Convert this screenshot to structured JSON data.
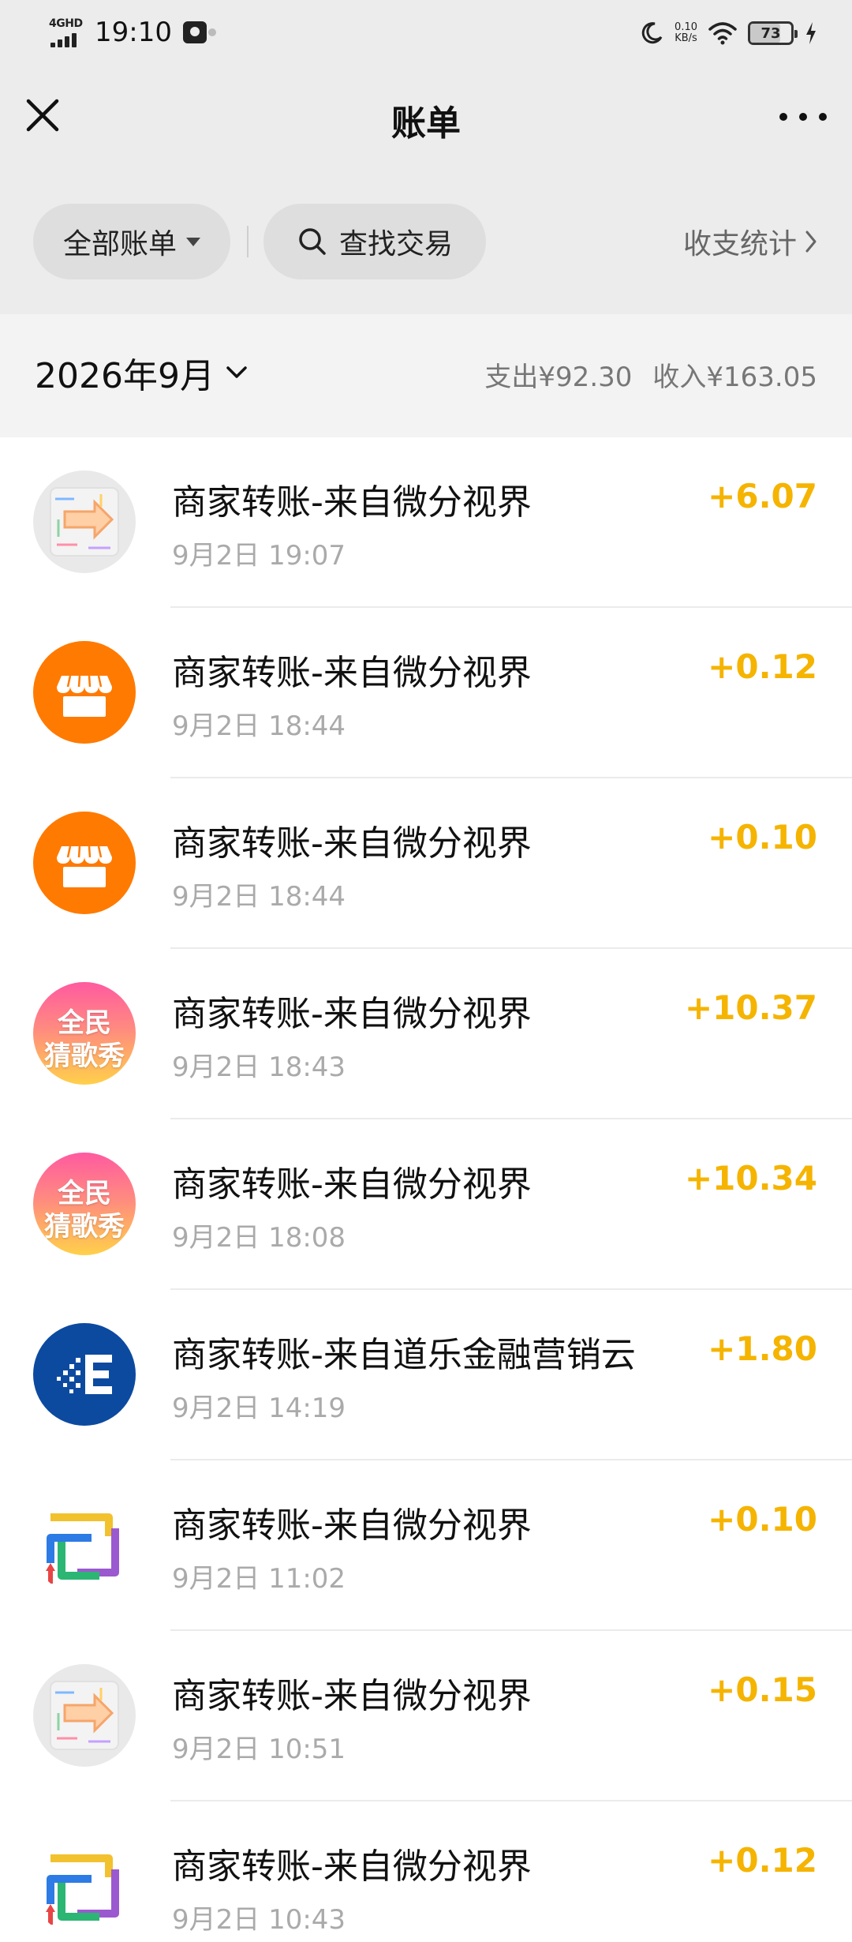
{
  "status_bar": {
    "network": "4GHD",
    "time": "19:10",
    "speed_value": "0.10",
    "speed_unit": "KB/s",
    "battery": "73"
  },
  "nav": {
    "title": "账单"
  },
  "filters": {
    "all_bills_label": "全部账单",
    "search_label": "查找交易",
    "stats_label": "收支统计"
  },
  "summary": {
    "month": "2026年9月",
    "expense": "支出¥92.30",
    "income": "收入¥163.05"
  },
  "transactions": [
    {
      "title": "商家转账-来自微分视界",
      "time": "9月2日 19:07",
      "amount": "+6.07",
      "icon": "arrows-maze-icon"
    },
    {
      "title": "商家转账-来自微分视界",
      "time": "9月2日 18:44",
      "amount": "+0.12",
      "icon": "store-icon"
    },
    {
      "title": "商家转账-来自微分视界",
      "time": "9月2日 18:44",
      "amount": "+0.10",
      "icon": "store-icon"
    },
    {
      "title": "商家转账-来自微分视界",
      "time": "9月2日 18:43",
      "amount": "+10.37",
      "icon": "song-game-logo",
      "logo_line1": "全民",
      "logo_line2": "猜歌秀"
    },
    {
      "title": "商家转账-来自微分视界",
      "time": "9月2日 18:08",
      "amount": "+10.34",
      "icon": "song-game-logo",
      "logo_line1": "全民",
      "logo_line2": "猜歌秀"
    },
    {
      "title": "商家转账-来自道乐金融营销云",
      "time": "9月2日 14:19",
      "amount": "+1.80",
      "icon": "e-logo-icon"
    },
    {
      "title": "商家转账-来自微分视界",
      "time": "9月2日 11:02",
      "amount": "+0.10",
      "icon": "arrows-loop-icon"
    },
    {
      "title": "商家转账-来自微分视界",
      "time": "9月2日 10:51",
      "amount": "+0.15",
      "icon": "arrows-maze-icon"
    },
    {
      "title": "商家转账-来自微分视界",
      "time": "9月2日 10:43",
      "amount": "+0.12",
      "icon": "arrows-loop-icon"
    }
  ],
  "colors": {
    "income_amount": "#f5b400",
    "header_bg": "#ececec",
    "store_orange": "#ff7a00",
    "brand_blue": "#0c4aa0"
  }
}
